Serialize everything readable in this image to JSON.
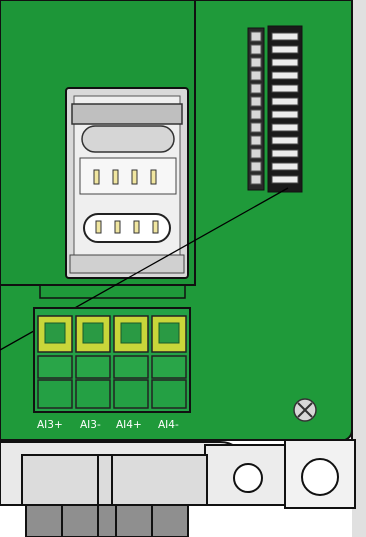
{
  "colors": {
    "board": "#1f9a3a",
    "board_dark": "#167a2b",
    "outline": "#111111",
    "terminal_body": "#2aa64a",
    "terminal_screw": "#c9d63a",
    "metal": "#cfcfcf",
    "enclosure": "#e6e6e6",
    "label": "#ffffff"
  },
  "terminal_labels": [
    "AI3+",
    "AI3-",
    "AI4+",
    "AI4-"
  ],
  "icons": [
    "sim-card-holder",
    "dip-switch-header",
    "screw-terminal-block",
    "mounting-screw",
    "mounting-hole",
    "cable-gland"
  ]
}
